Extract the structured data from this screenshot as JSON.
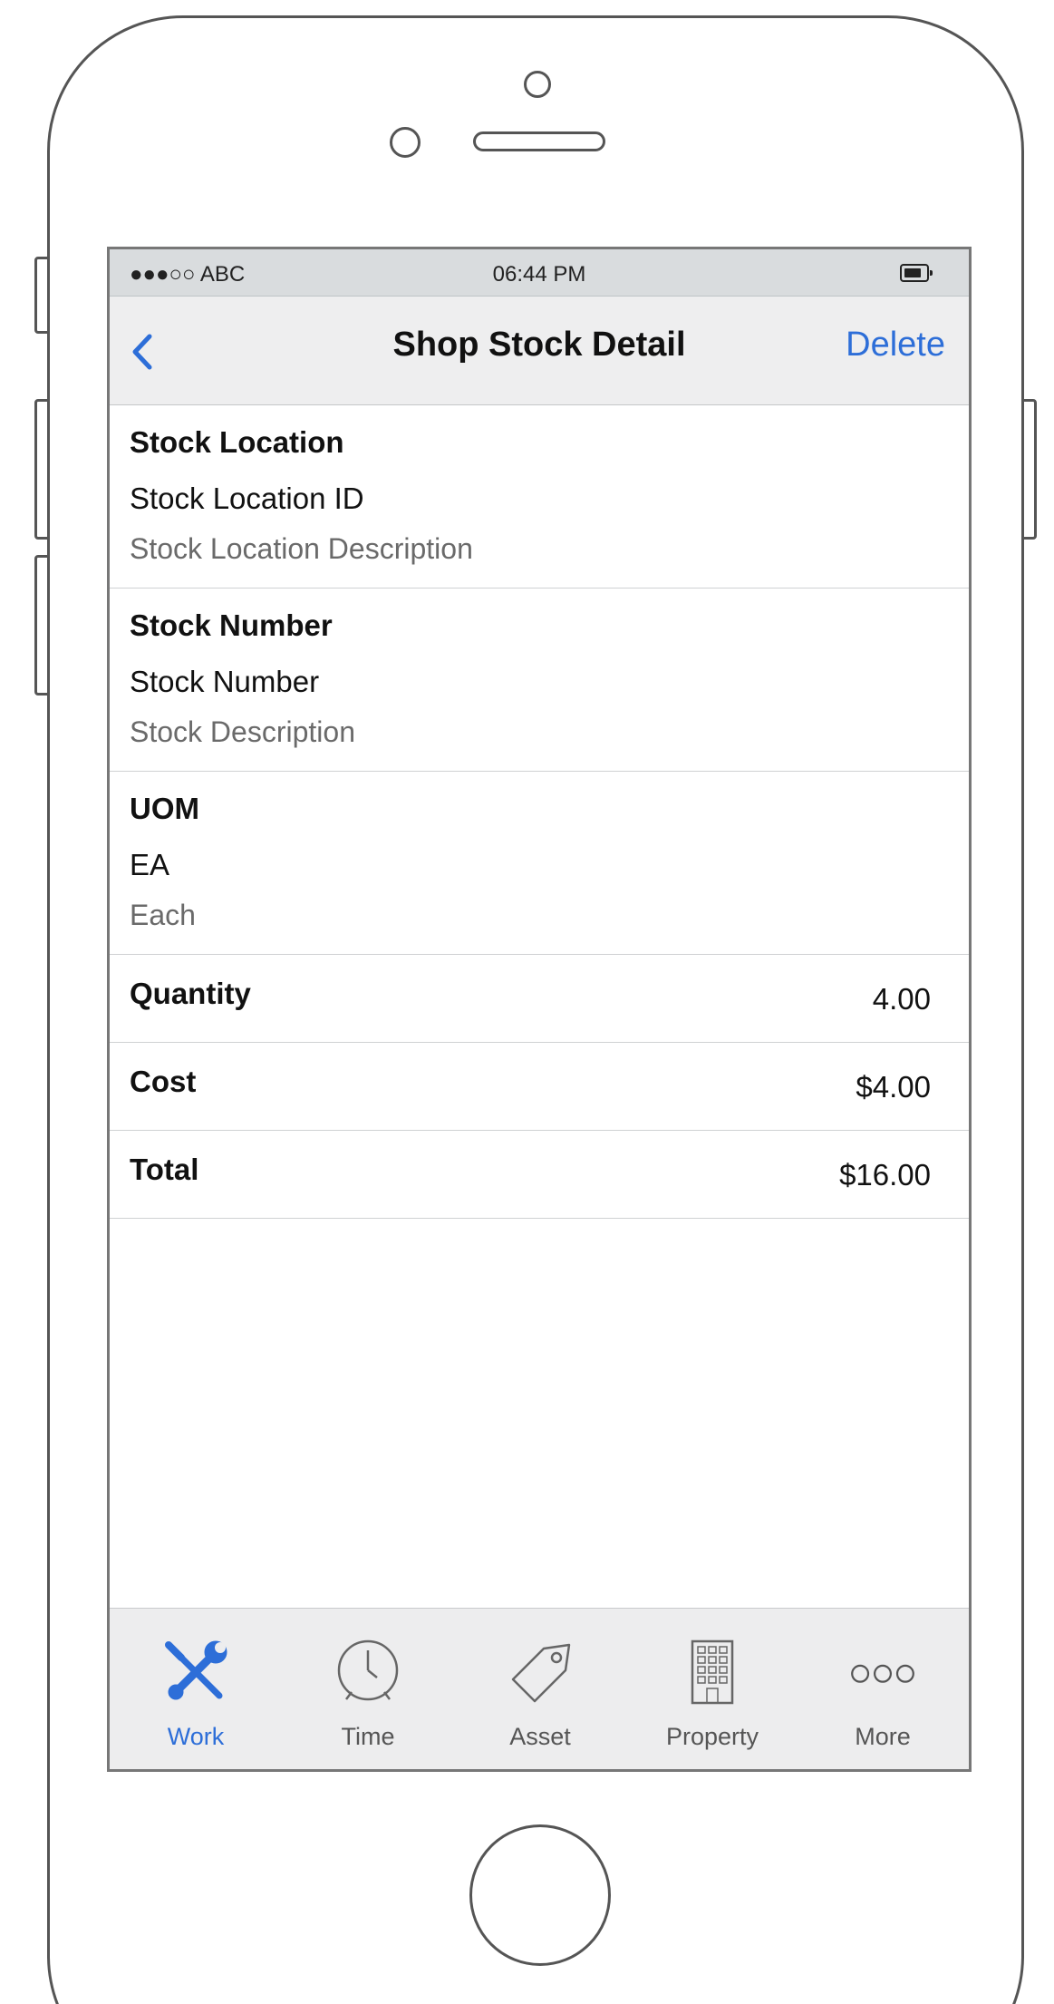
{
  "status_bar": {
    "carrier": "●●●○○ ABC",
    "time": "06:44 PM"
  },
  "nav": {
    "title": "Shop Stock Detail",
    "action": "Delete"
  },
  "sections": [
    {
      "label": "Stock Location",
      "primary": "Stock Location ID",
      "secondary": "Stock Location Description"
    },
    {
      "label": "Stock Number",
      "primary": "Stock Number",
      "secondary": "Stock Description"
    },
    {
      "label": "UOM",
      "primary": "EA",
      "secondary": "Each"
    }
  ],
  "rows": [
    {
      "label": "Quantity",
      "value": "4.00"
    },
    {
      "label": "Cost",
      "value": "$4.00"
    },
    {
      "label": "Total",
      "value": "$16.00"
    }
  ],
  "tabs": [
    {
      "label": "Work",
      "icon": "tools-icon",
      "active": true
    },
    {
      "label": "Time",
      "icon": "clock-icon",
      "active": false
    },
    {
      "label": "Asset",
      "icon": "tag-icon",
      "active": false
    },
    {
      "label": "Property",
      "icon": "building-icon",
      "active": false
    },
    {
      "label": "More",
      "icon": "more-icon",
      "active": false
    }
  ],
  "colors": {
    "accent": "#2d6ed8",
    "status_bar_bg": "#d9dcde",
    "nav_bg": "#eeeeef",
    "tab_bar_bg": "#ededee",
    "secondary_text": "#6a6a6a"
  }
}
